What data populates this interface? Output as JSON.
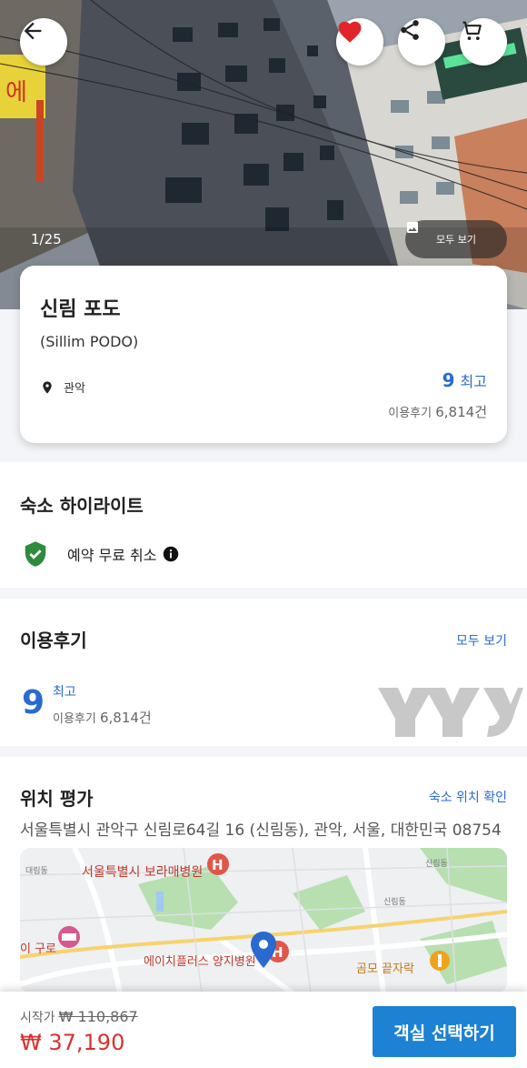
{
  "gallery": {
    "counter": "1/25",
    "view_all_label": "모두 보기"
  },
  "hotel": {
    "name": "신림 포도",
    "english_name": "(Sillim PODO)",
    "location": "관악",
    "score": "9",
    "score_label": "최고",
    "reviews_label": "이용후기",
    "reviews_count": "6,814건"
  },
  "highlights": {
    "title": "숙소 하이라이트",
    "item_label": "예약 무료 취소"
  },
  "reviews_section": {
    "title": "이용후기",
    "view_all_label": "모두 보기",
    "score": "9",
    "score_label": "최고",
    "reviews_label": "이용후기",
    "reviews_count": "6,814건",
    "source_logo_text": "YJYJ"
  },
  "location_section": {
    "title": "위치 평가",
    "check_link": "숙소 위치 확인",
    "address": "서울특별시 관악구 신림로64길 16 (신림동), 관악, 서울, 대한민국 08754",
    "map_labels": {
      "hospital_1": "서울특별시 보라매병원",
      "hospital_2": "에이치플러스 양지병원",
      "restaurant": "곰모 끝자락",
      "district": "이 구로",
      "area_1": "대림동",
      "area_2": "신림동",
      "area_3": "신림동"
    }
  },
  "bottom_bar": {
    "start_label": "시작가",
    "original_price": "₩ 110,867",
    "final_price": "₩ 37,190",
    "select_button": "객실 선택하기"
  },
  "colors": {
    "accent_blue": "#2a6ad0",
    "price_red": "#d8322f",
    "button_blue": "#1d82d4",
    "heart_red": "#e0262b",
    "shield_green": "#2e8b3c"
  }
}
